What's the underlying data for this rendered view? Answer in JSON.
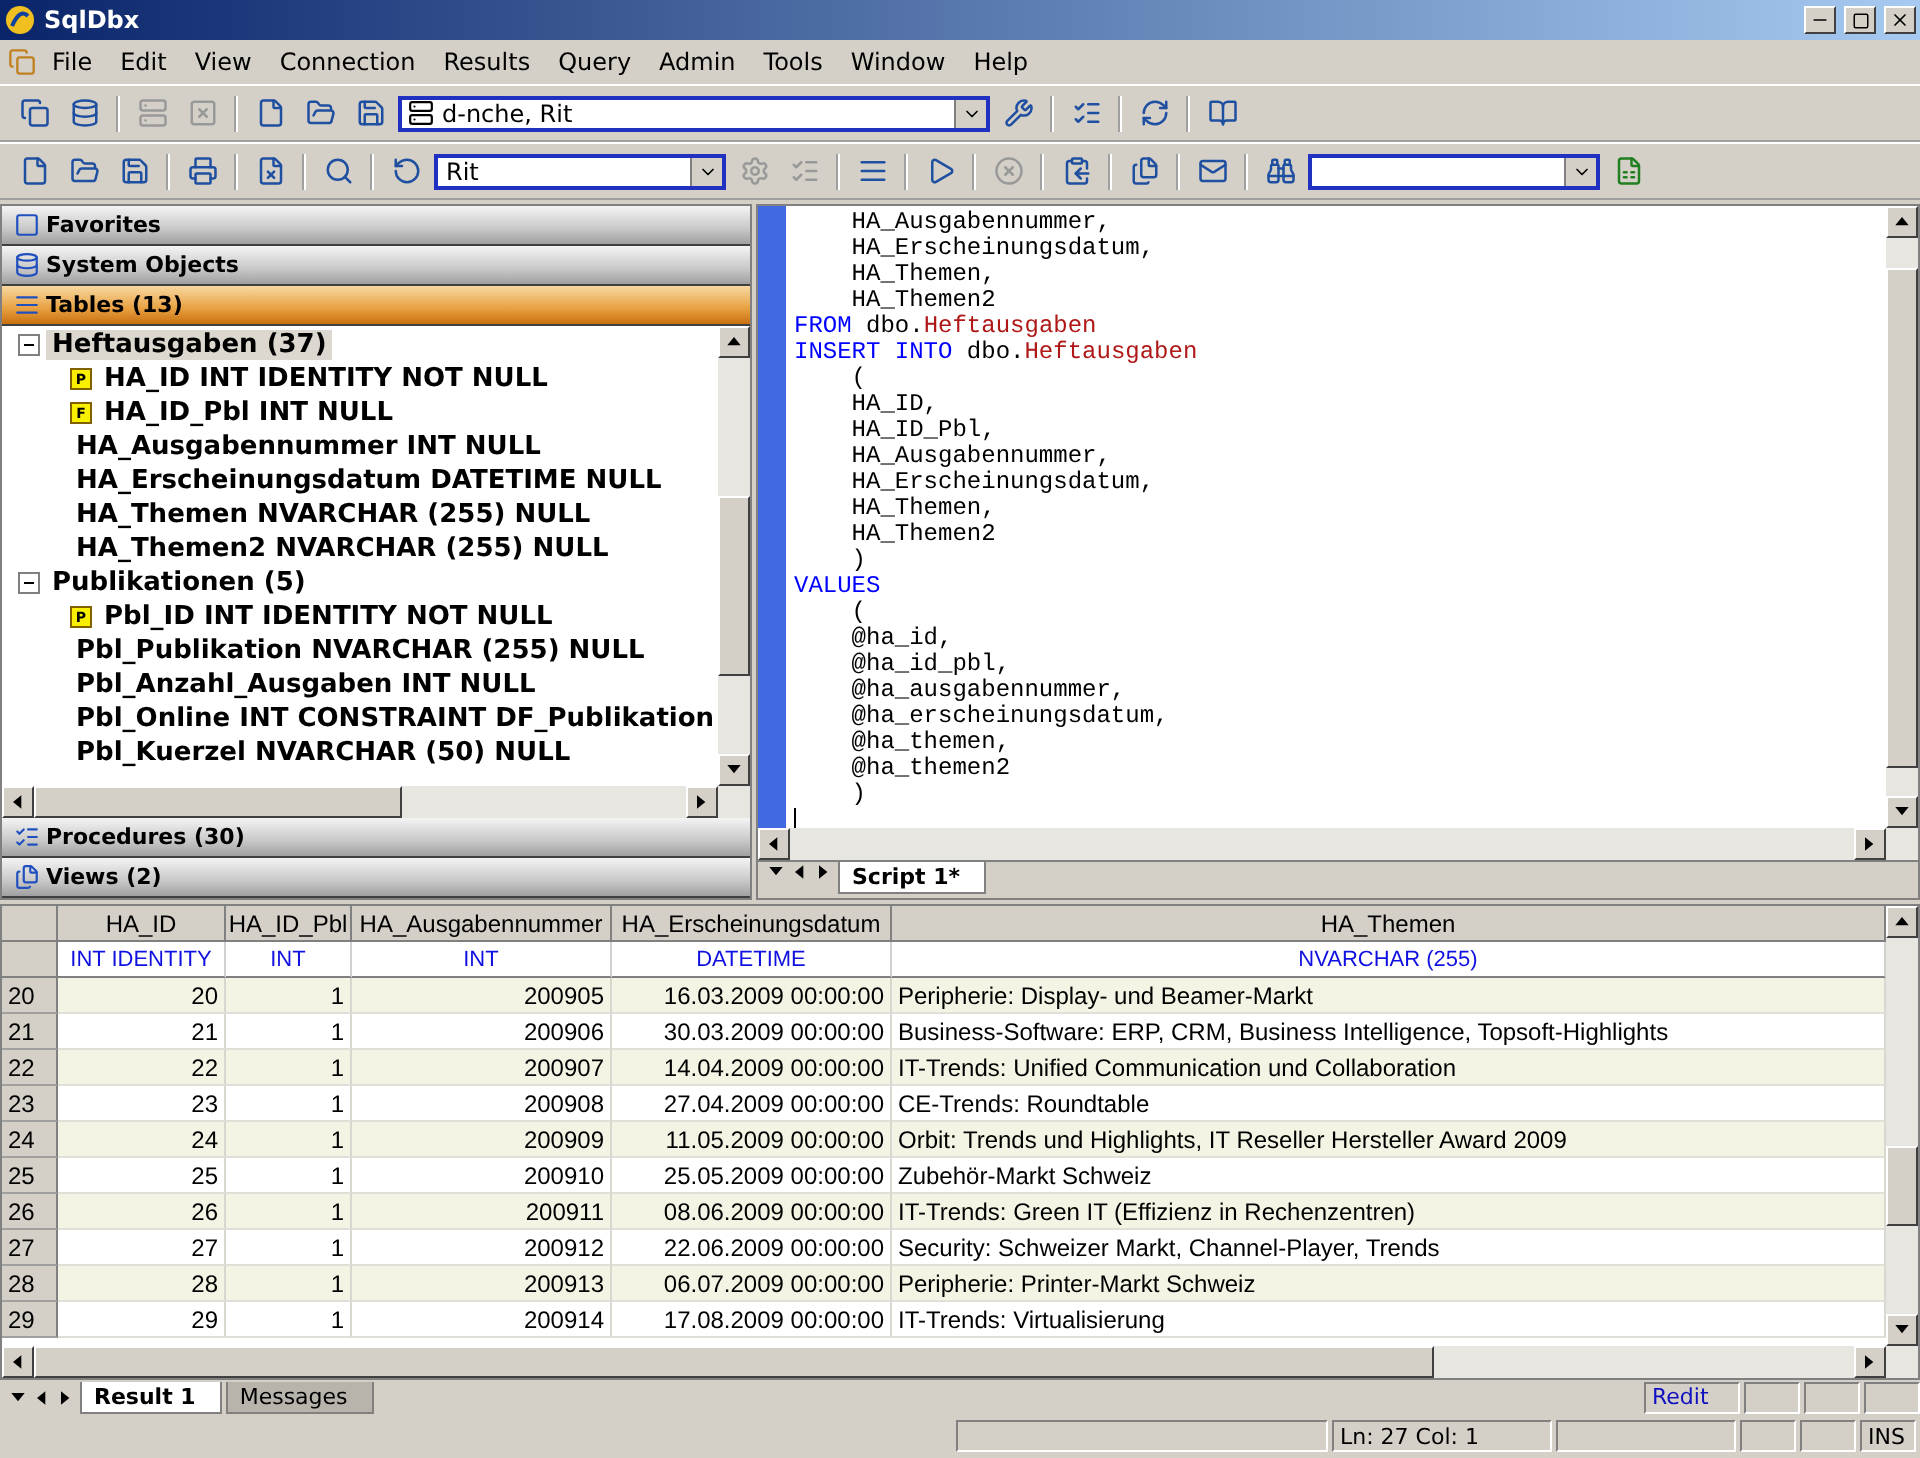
{
  "window": {
    "title": "SqlDbx"
  },
  "menu": [
    {
      "label": "File"
    },
    {
      "label": "Edit"
    },
    {
      "label": "View"
    },
    {
      "label": "Connection"
    },
    {
      "label": "Results"
    },
    {
      "label": "Query"
    },
    {
      "label": "Admin"
    },
    {
      "label": "Tools"
    },
    {
      "label": "Window"
    },
    {
      "label": "Help"
    }
  ],
  "connection_select": {
    "value": "d-nche, Rit"
  },
  "database_select": {
    "value": "Rit"
  },
  "sidebar": {
    "sections_top": [
      {
        "label": "Favorites",
        "selected": false
      },
      {
        "label": "System Objects",
        "selected": false
      },
      {
        "label": "Tables (13)",
        "selected": true
      }
    ],
    "tree": [
      {
        "label": "Heftausgaben (37)",
        "expanded": true,
        "selected": true,
        "children": [
          {
            "label": "HA_ID INT IDENTITY NOT NULL",
            "badge": "P"
          },
          {
            "label": "HA_ID_Pbl INT NULL",
            "badge": "F"
          },
          {
            "label": "HA_Ausgabennummer INT NULL"
          },
          {
            "label": "HA_Erscheinungsdatum DATETIME NULL"
          },
          {
            "label": "HA_Themen NVARCHAR (255) NULL"
          },
          {
            "label": "HA_Themen2 NVARCHAR (255) NULL"
          }
        ]
      },
      {
        "label": "Publikationen (5)",
        "expanded": true,
        "selected": false,
        "children": [
          {
            "label": "Pbl_ID INT IDENTITY NOT NULL",
            "badge": "P"
          },
          {
            "label": "Pbl_Publikation NVARCHAR (255) NULL"
          },
          {
            "label": "Pbl_Anzahl_Ausgaben INT NULL"
          },
          {
            "label": "Pbl_Online INT CONSTRAINT DF_Publikation"
          },
          {
            "label": "Pbl_Kuerzel NVARCHAR (50) NULL"
          }
        ]
      }
    ],
    "sections_bottom": [
      {
        "label": "Procedures (30)",
        "selected": false
      },
      {
        "label": "Views (2)",
        "selected": false
      }
    ]
  },
  "editor": {
    "lines": [
      [
        {
          "kind": "plain",
          "text": "    HA_Ausgabennummer,"
        }
      ],
      [
        {
          "kind": "plain",
          "text": "    HA_Erscheinungsdatum,"
        }
      ],
      [
        {
          "kind": "plain",
          "text": "    HA_Themen,"
        }
      ],
      [
        {
          "kind": "plain",
          "text": "    HA_Themen2"
        }
      ],
      [
        {
          "kind": "keyword",
          "text": "FROM"
        },
        {
          "kind": "plain",
          "text": " dbo."
        },
        {
          "kind": "table",
          "text": "Heftausgaben"
        }
      ],
      [
        {
          "kind": "keyword",
          "text": "INSERT INTO"
        },
        {
          "kind": "plain",
          "text": " dbo."
        },
        {
          "kind": "table",
          "text": "Heftausgaben"
        }
      ],
      [
        {
          "kind": "plain",
          "text": "    ("
        }
      ],
      [
        {
          "kind": "plain",
          "text": "    HA_ID,"
        }
      ],
      [
        {
          "kind": "plain",
          "text": "    HA_ID_Pbl,"
        }
      ],
      [
        {
          "kind": "plain",
          "text": "    HA_Ausgabennummer,"
        }
      ],
      [
        {
          "kind": "plain",
          "text": "    HA_Erscheinungsdatum,"
        }
      ],
      [
        {
          "kind": "plain",
          "text": "    HA_Themen,"
        }
      ],
      [
        {
          "kind": "plain",
          "text": "    HA_Themen2"
        }
      ],
      [
        {
          "kind": "plain",
          "text": "    )"
        }
      ],
      [
        {
          "kind": "keyword",
          "text": "VALUES"
        }
      ],
      [
        {
          "kind": "plain",
          "text": "    ("
        }
      ],
      [
        {
          "kind": "plain",
          "text": "    @ha_id,"
        }
      ],
      [
        {
          "kind": "plain",
          "text": "    @ha_id_pbl,"
        }
      ],
      [
        {
          "kind": "plain",
          "text": "    @ha_ausgabennummer,"
        }
      ],
      [
        {
          "kind": "plain",
          "text": "    @ha_erscheinungsdatum,"
        }
      ],
      [
        {
          "kind": "plain",
          "text": "    @ha_themen,"
        }
      ],
      [
        {
          "kind": "plain",
          "text": "    @ha_themen2"
        }
      ],
      [
        {
          "kind": "plain",
          "text": "    )"
        }
      ]
    ],
    "tabs": [
      {
        "label": "Script 1*",
        "selected": true
      }
    ]
  },
  "results": {
    "columns": [
      {
        "name": "HA_ID",
        "type": "INT IDENTITY"
      },
      {
        "name": "HA_ID_Pbl",
        "type": "INT"
      },
      {
        "name": "HA_Ausgabennummer",
        "type": "INT"
      },
      {
        "name": "HA_Erscheinungsdatum",
        "type": "DATETIME"
      },
      {
        "name": "HA_Themen",
        "type": "NVARCHAR (255)"
      }
    ],
    "rows": [
      {
        "num": "20",
        "cells": [
          "20",
          "1",
          "200905",
          "16.03.2009 00:00:00",
          "Peripherie: Display- und Beamer-Markt"
        ]
      },
      {
        "num": "21",
        "cells": [
          "21",
          "1",
          "200906",
          "30.03.2009 00:00:00",
          "Business-Software: ERP, CRM, Business Intelligence, Topsoft-Highlights"
        ]
      },
      {
        "num": "22",
        "cells": [
          "22",
          "1",
          "200907",
          "14.04.2009 00:00:00",
          "IT-Trends: Unified Communication und Collaboration"
        ]
      },
      {
        "num": "23",
        "cells": [
          "23",
          "1",
          "200908",
          "27.04.2009 00:00:00",
          "CE-Trends: Roundtable"
        ]
      },
      {
        "num": "24",
        "cells": [
          "24",
          "1",
          "200909",
          "11.05.2009 00:00:00",
          "Orbit: Trends und Highlights,  IT Reseller Hersteller Award 2009"
        ]
      },
      {
        "num": "25",
        "cells": [
          "25",
          "1",
          "200910",
          "25.05.2009 00:00:00",
          "Zubehör-Markt Schweiz"
        ]
      },
      {
        "num": "26",
        "cells": [
          "26",
          "1",
          "200911",
          "08.06.2009 00:00:00",
          "IT-Trends: Green IT (Effizienz in Rechenzentren)"
        ]
      },
      {
        "num": "27",
        "cells": [
          "27",
          "1",
          "200912",
          "22.06.2009 00:00:00",
          "Security: Schweizer Markt, Channel-Player, Trends"
        ]
      },
      {
        "num": "28",
        "cells": [
          "28",
          "1",
          "200913",
          "06.07.2009 00:00:00",
          "Peripherie: Printer-Markt Schweiz"
        ]
      },
      {
        "num": "29",
        "cells": [
          "29",
          "1",
          "200914",
          "17.08.2009 00:00:00",
          "IT-Trends: Virtualisierung"
        ]
      }
    ],
    "tabs": [
      {
        "label": "Result 1",
        "selected": true
      },
      {
        "label": "Messages",
        "selected": false
      }
    ]
  },
  "status_bar": {
    "mode": "Redit",
    "position": "Ln: 27  Col: 1",
    "insert": "INS"
  }
}
